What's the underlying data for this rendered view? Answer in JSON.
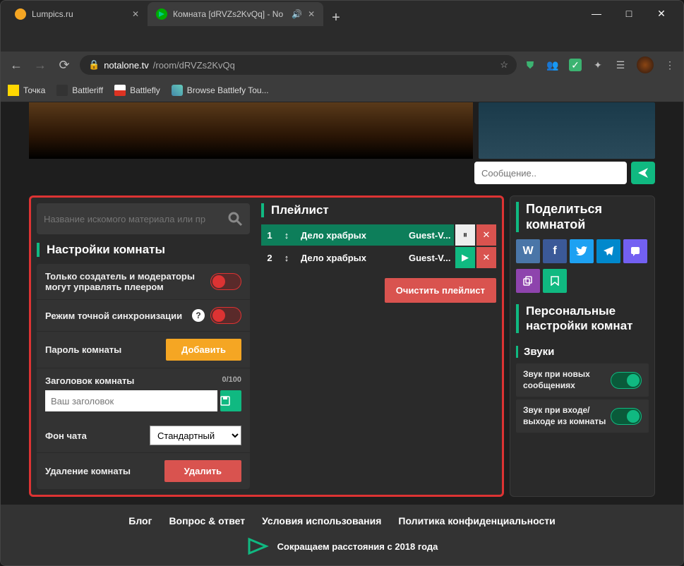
{
  "window": {
    "minimize": "—",
    "maximize": "□",
    "close": "✕"
  },
  "tabs": [
    {
      "title": "Lumpics.ru",
      "active": false
    },
    {
      "title": "Комната [dRVZs2KvQq] - No",
      "active": true,
      "audio": true
    }
  ],
  "address": {
    "url_domain": "notalone.tv",
    "url_path": "/room/dRVZs2KvQq"
  },
  "bookmarks": [
    {
      "label": "Точка"
    },
    {
      "label": "Battleriff"
    },
    {
      "label": "Battlefly"
    },
    {
      "label": "Browse Battlefy Tou..."
    }
  ],
  "chat": {
    "placeholder": "Сообщение.."
  },
  "search": {
    "placeholder": "Название искомого материала или пр"
  },
  "settings": {
    "title": "Настройки комнаты",
    "moderator_label": "Только создатель и модераторы могут управлять плеером",
    "sync_label": "Режим точной синхронизации",
    "password_label": "Пароль комнаты",
    "password_btn": "Добавить",
    "room_title_label": "Заголовок комнаты",
    "room_title_counter": "0/100",
    "room_title_placeholder": "Ваш заголовок",
    "chat_bg_label": "Фон чата",
    "chat_bg_value": "Стандартный",
    "delete_label": "Удаление комнаты",
    "delete_btn": "Удалить"
  },
  "playlist": {
    "title": "Плейлист",
    "items": [
      {
        "index": "1",
        "title": "Дело храбрых",
        "user": "Guest-V...",
        "active": true
      },
      {
        "index": "2",
        "title": "Дело храбрых",
        "user": "Guest-V...",
        "active": false
      }
    ],
    "clear_btn": "Очистить плейлист"
  },
  "share": {
    "title": "Поделиться комнатой"
  },
  "personal": {
    "title": "Персональные настройки комнат",
    "sounds_title": "Звуки",
    "sound_new_msg": "Звук при новых сообщениях",
    "sound_enter_exit": "Звук при входе/выходе из комнаты"
  },
  "footer": {
    "links": [
      "Блог",
      "Вопрос & ответ",
      "Условия использования",
      "Политика конфиденциальности"
    ],
    "tagline": "Сокращаем расстояния с 2018 года"
  }
}
